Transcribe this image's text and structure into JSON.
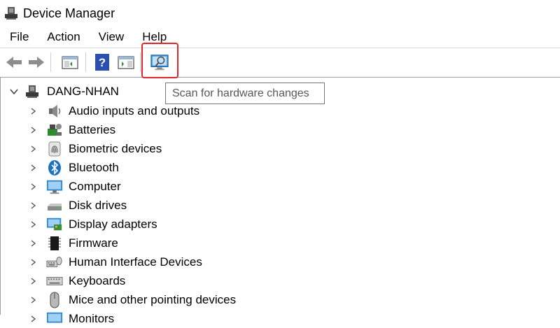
{
  "window": {
    "title": "Device Manager"
  },
  "menu": [
    "File",
    "Action",
    "View",
    "Help"
  ],
  "toolbar": {
    "buttons": [
      "back-icon",
      "forward-icon",
      "show-hide-console-tree-icon",
      "help-icon",
      "action-pane-icon",
      "scan-hardware-icon"
    ],
    "tooltip": "Scan for hardware changes"
  },
  "tree": {
    "root": "DANG-NHAN",
    "categories": [
      "Audio inputs and outputs",
      "Batteries",
      "Biometric devices",
      "Bluetooth",
      "Computer",
      "Disk drives",
      "Display adapters",
      "Firmware",
      "Human Interface Devices",
      "Keyboards",
      "Mice and other pointing devices",
      "Monitors"
    ]
  },
  "colors": {
    "highlight": "#e0262b",
    "accent": "#1e73be"
  }
}
